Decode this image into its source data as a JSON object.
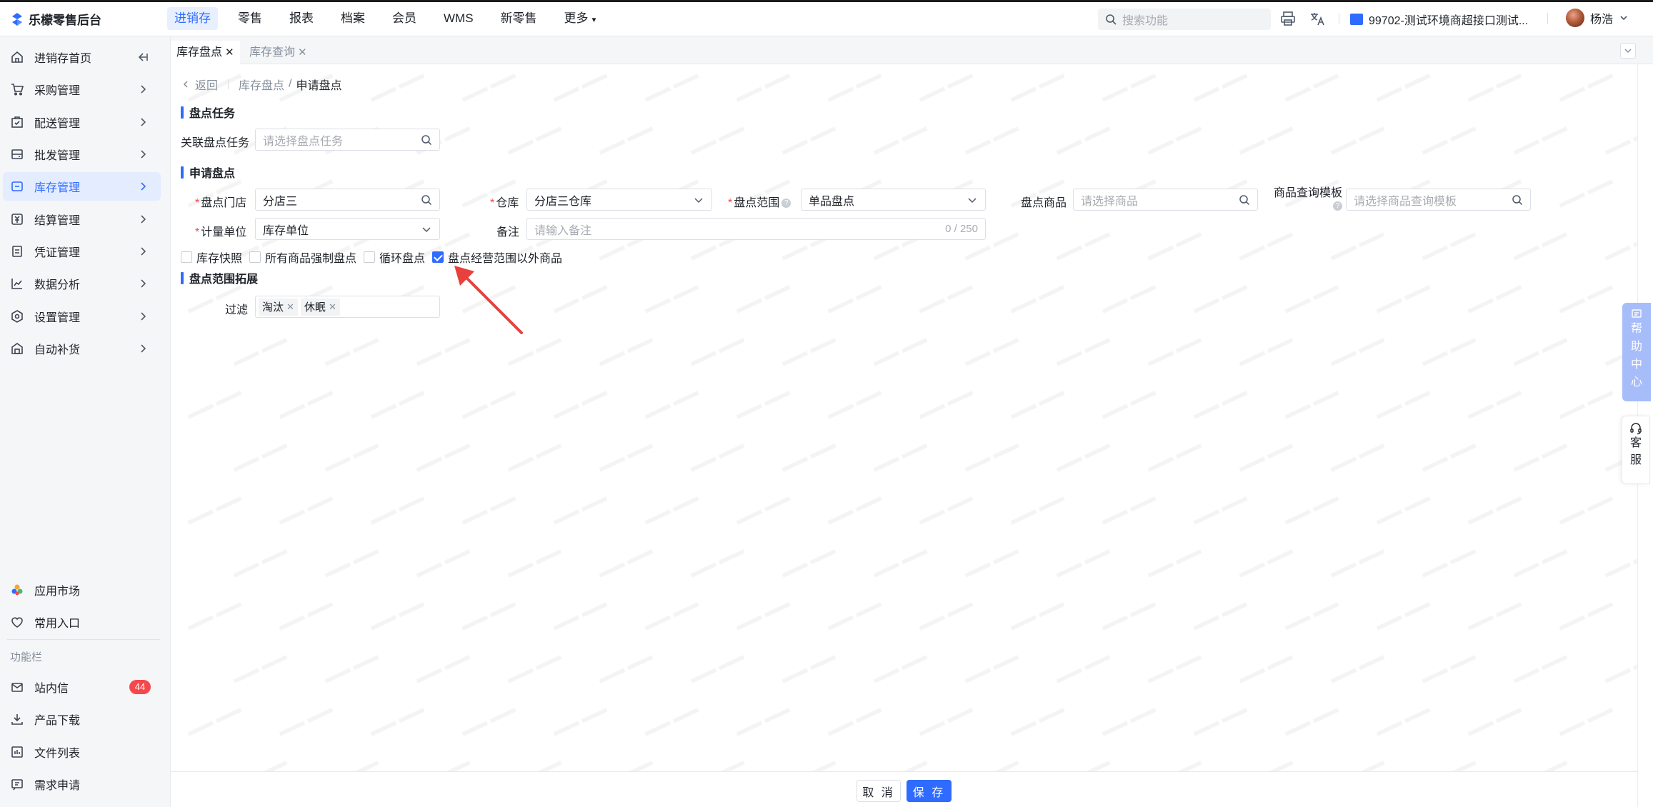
{
  "app": {
    "name": "乐檬零售后台"
  },
  "topnav": {
    "items": [
      {
        "label": "进销存",
        "active": true
      },
      {
        "label": "零售"
      },
      {
        "label": "报表"
      },
      {
        "label": "档案"
      },
      {
        "label": "会员"
      },
      {
        "label": "WMS"
      },
      {
        "label": "新零售"
      },
      {
        "label": "更多"
      }
    ],
    "search_placeholder": "搜索功能",
    "store": "99702-测试环境商超接口测试...",
    "user": "杨浩"
  },
  "sidebar": {
    "items": [
      {
        "label": "进销存首页"
      },
      {
        "label": "采购管理"
      },
      {
        "label": "配送管理"
      },
      {
        "label": "批发管理"
      },
      {
        "label": "库存管理",
        "active": true
      },
      {
        "label": "结算管理"
      },
      {
        "label": "凭证管理"
      },
      {
        "label": "数据分析"
      },
      {
        "label": "设置管理"
      },
      {
        "label": "自动补货"
      }
    ],
    "bottom": [
      {
        "label": "应用市场"
      },
      {
        "label": "常用入口"
      }
    ],
    "func_heading": "功能栏",
    "func": [
      {
        "label": "站内信",
        "badge": "44"
      },
      {
        "label": "产品下载"
      },
      {
        "label": "文件列表"
      },
      {
        "label": "需求申请"
      }
    ]
  },
  "tabs": [
    {
      "label": "库存盘点",
      "active": true,
      "close": "✕"
    },
    {
      "label": "库存查询",
      "active": false,
      "close": "✕"
    }
  ],
  "breadcrumb": {
    "back": "返回",
    "parent": "库存盘点",
    "sep": "/",
    "current": "申请盘点"
  },
  "section1": {
    "title": "盘点任务",
    "task_label": "关联盘点任务",
    "task_placeholder": "请选择盘点任务"
  },
  "section2": {
    "title": "申请盘点",
    "store_label": "盘点门店",
    "store_value": "分店三",
    "warehouse_label": "仓库",
    "warehouse_value": "分店三仓库",
    "scope_label": "盘点范围",
    "scope_value": "单品盘点",
    "goods_label": "盘点商品",
    "goods_placeholder": "请选择商品",
    "template_label": "商品查询模板",
    "template_placeholder": "请选择商品查询模板",
    "unit_label": "计量单位",
    "unit_value": "库存单位",
    "remark_label": "备注",
    "remark_placeholder": "请输入备注",
    "remark_count": "0 / 250",
    "checkboxes": [
      {
        "label": "库存快照",
        "checked": false
      },
      {
        "label": "所有商品强制盘点",
        "checked": false
      },
      {
        "label": "循环盘点",
        "checked": false
      },
      {
        "label": "盘点经营范围以外商品",
        "checked": true
      }
    ]
  },
  "section3": {
    "title": "盘点范围拓展",
    "filter_label": "过滤",
    "tags": [
      "淘汰",
      "休眠"
    ]
  },
  "footer": {
    "cancel": "取 消",
    "save": "保 存"
  },
  "right_rail": {
    "help": [
      "帮",
      "助",
      "中",
      "心"
    ],
    "service": [
      "客",
      "服"
    ]
  },
  "colors": {
    "primary": "#2f6bff",
    "danger": "#f5484d",
    "annotation": "#e8403c"
  }
}
